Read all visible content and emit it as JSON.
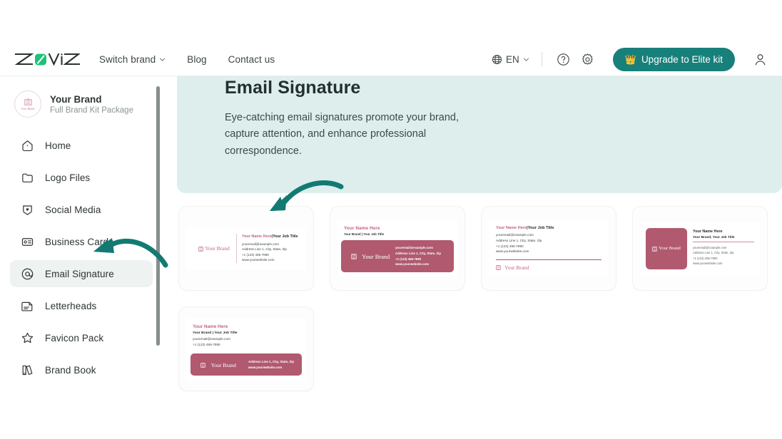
{
  "header": {
    "logo_text": "ZAVIZ",
    "nav": [
      {
        "label": "Switch brand",
        "icon": "chevron-down-icon",
        "has_chevron": true
      },
      {
        "label": "Blog",
        "has_chevron": false
      },
      {
        "label": "Contact us",
        "has_chevron": false
      }
    ],
    "language": {
      "label": "EN",
      "icon": "globe-icon",
      "chevron": "chevron-down-icon"
    },
    "help_icon": "help-circle-icon",
    "settings_icon": "gear-icon",
    "upgrade_button": {
      "label": "Upgrade to Elite kit",
      "icon": "crown-icon",
      "color": "#17807a"
    },
    "account_icon": "user-avatar-icon"
  },
  "sidebar": {
    "brand": {
      "name": "Your Brand",
      "package": "Full Brand Kit Package",
      "logo_caption": "Your Brand"
    },
    "items": [
      {
        "label": "Home",
        "icon": "home-icon",
        "active": false
      },
      {
        "label": "Logo Files",
        "icon": "folder-icon",
        "active": false
      },
      {
        "label": "Social Media",
        "icon": "shield-heart-icon",
        "active": false
      },
      {
        "label": "Business Cards",
        "icon": "id-card-icon",
        "active": false
      },
      {
        "label": "Email Signature",
        "icon": "at-sign-icon",
        "active": true
      },
      {
        "label": "Letterheads",
        "icon": "document-icon",
        "active": false
      },
      {
        "label": "Favicon Pack",
        "icon": "star-icon",
        "active": false
      },
      {
        "label": "Brand Book",
        "icon": "book-icon",
        "active": false
      }
    ]
  },
  "main": {
    "hero": {
      "title": "Email Signature",
      "description": "Eye-catching email signatures promote your brand, capture attention, and enhance professional correspondence.",
      "background": "#ddeeed"
    },
    "signature_fields": {
      "name": "Your Name Here",
      "job_title": "Your Job Title",
      "brand": "Your Brand",
      "separator": "|",
      "brand_and_title": "Your Brand | Your Job Title",
      "brand_comma_title": "Your Brand, Your Job Title",
      "name_and_title": "Your Name Here | Your Job Title",
      "email": "youremail@example.com",
      "address": "Address Line 1, City, State, Zip",
      "phone": "+1 (123) 456-7890",
      "website": "www.yourwebsite.com",
      "logo_text": "Your Brand"
    },
    "templates": [
      {
        "id": "template-1",
        "layout": "logo-left-divider"
      },
      {
        "id": "template-2",
        "layout": "name-top-colorblock"
      },
      {
        "id": "template-3",
        "layout": "details-top-rule-logo"
      },
      {
        "id": "template-4",
        "layout": "logo-block-left"
      },
      {
        "id": "template-5",
        "layout": "details-top-colorbar"
      }
    ],
    "accent_colors": {
      "rose": "#b0596f",
      "pink": "#c0657e",
      "teal": "#17807a"
    }
  },
  "annotations": {
    "arrow_to_template": "arrow-pointing-to-first-template",
    "arrow_to_sidebar": "arrow-pointing-to-email-signature-menu",
    "color": "#127a72"
  }
}
